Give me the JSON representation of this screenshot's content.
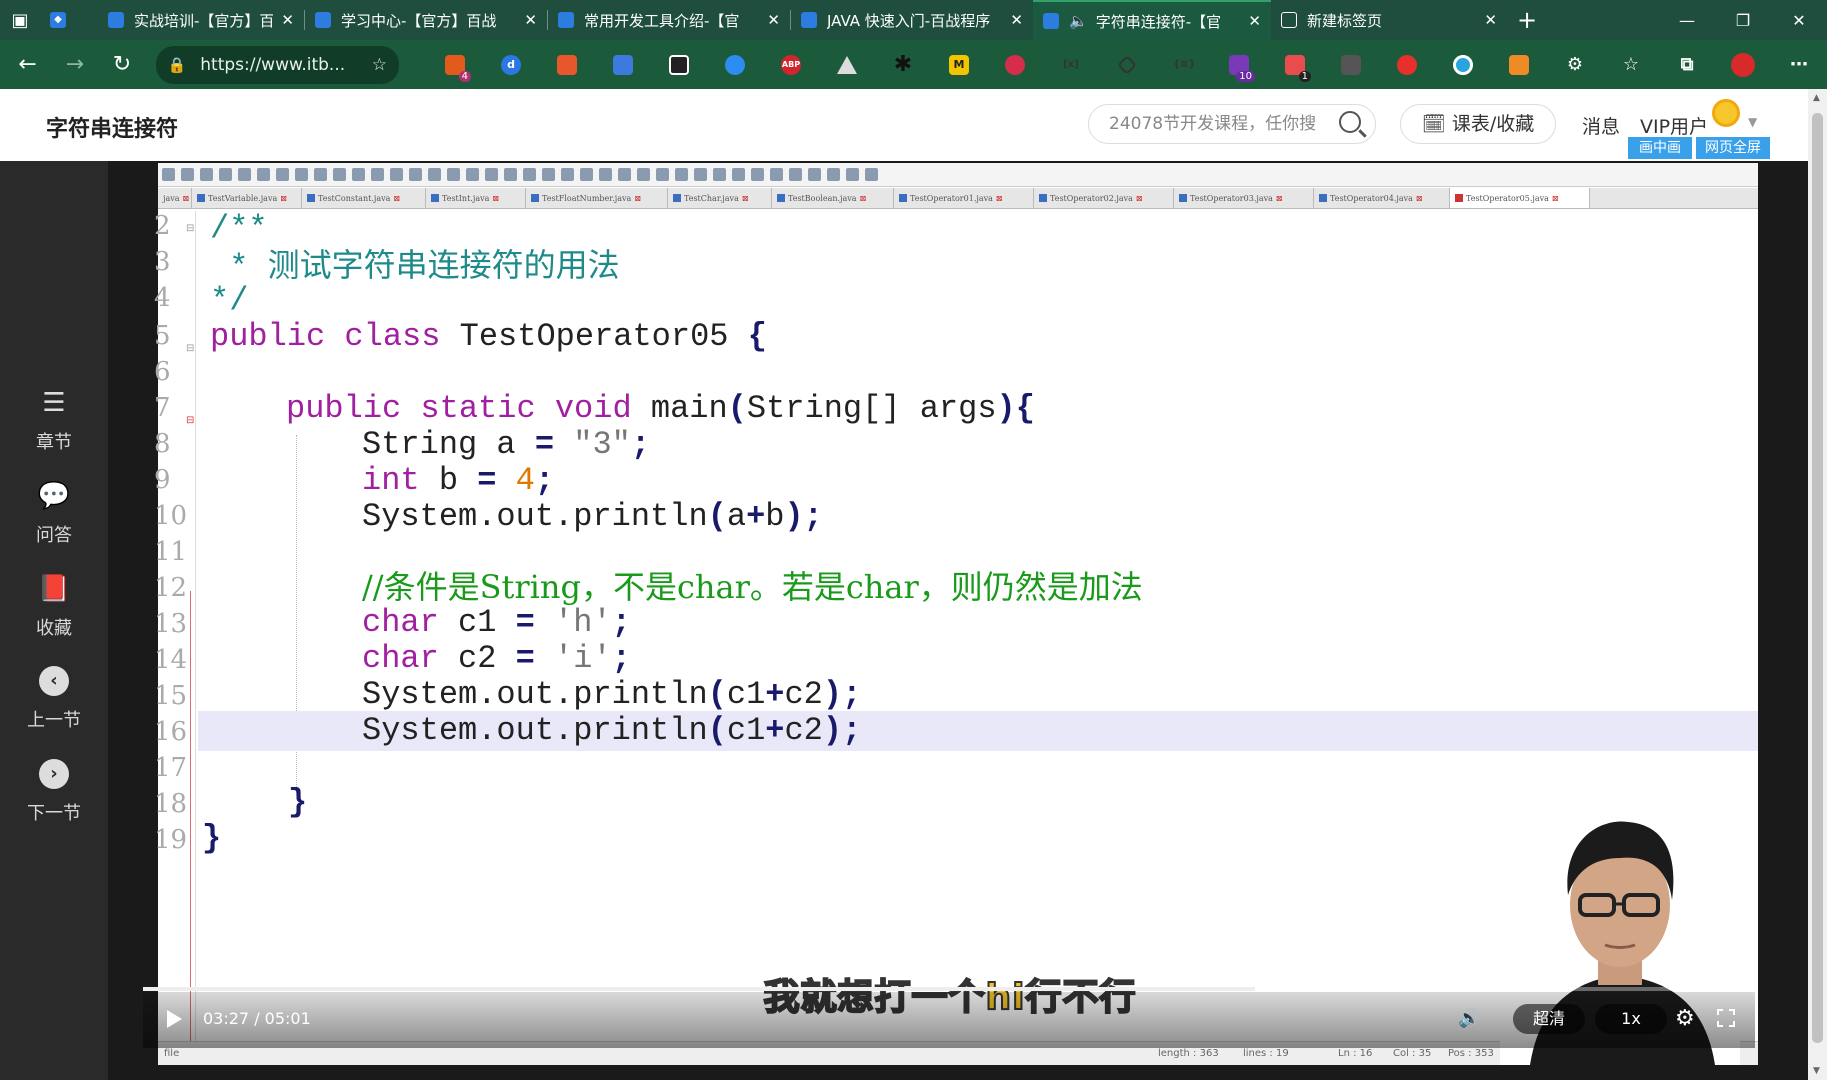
{
  "browser": {
    "tabs": [
      {
        "title": "实战培训-【官方】百战",
        "active": false
      },
      {
        "title": "学习中心-【官方】百战",
        "active": false
      },
      {
        "title": "常用开发工具介绍-【官",
        "active": false
      },
      {
        "title": "JAVA 快速入门-百战程序",
        "active": false
      },
      {
        "title": "字符串连接符-【官",
        "active": true
      },
      {
        "title": "新建标签页",
        "active": false
      }
    ],
    "new_tab": "+",
    "url": "https://www.itb...",
    "extension_badges": {
      "ext1": "4",
      "ext17": "10",
      "ext18": "1"
    },
    "extension_labels": {
      "abp": "ABP",
      "m": "M"
    }
  },
  "header": {
    "title": "字符串连接符",
    "search_placeholder": "24078节开发课程，任你搜",
    "courses_button": "课表/收藏",
    "messages": "消息",
    "vip": "VIP用户",
    "pip": "画中画",
    "fullscreen_page": "网页全屏"
  },
  "sidebar": {
    "items": [
      {
        "label": "章节",
        "icon": "list-icon"
      },
      {
        "label": "问答",
        "icon": "chat-icon"
      },
      {
        "label": "收藏",
        "icon": "bookmark-icon"
      },
      {
        "label": "上一节",
        "icon": "chevron-left-icon"
      },
      {
        "label": "下一节",
        "icon": "chevron-right-icon"
      }
    ]
  },
  "editor": {
    "file_tabs": [
      "java",
      "TestVariable.java",
      "TestConstant.java",
      "TestInt.java",
      "TestFloatNumber.java",
      "TestChar.java",
      "TestBoolean.java",
      "TestOperator01.java",
      "TestOperator02.java",
      "TestOperator03.java",
      "TestOperator04.java",
      "TestOperator05.java"
    ],
    "active_file": "TestOperator05.java",
    "line_numbers": [
      "2",
      "3",
      "4",
      "5",
      "6",
      "7",
      "8",
      "9",
      "10",
      "11",
      "12",
      "13",
      "14",
      "15",
      "16",
      "17",
      "18",
      "19"
    ],
    "code": {
      "l2": "/**",
      "l3_star": " * ",
      "l3_text": "测试字符串连接符的用法",
      "l4": "*/",
      "l5_kw": "public class",
      "l5_name": " TestOperator05 ",
      "l5_brace": "{",
      "l7_kw": "public static void",
      "l7_rest": " main",
      "l7_paren": "(",
      "l7_args": "String[] args",
      "l7_close": "){",
      "l8_a": "String a ",
      "l8_eq": "=",
      "l8_str": " \"3\"",
      "l8_semi": ";",
      "l9_kw": "int",
      "l9_b": " b ",
      "l9_eq": "=",
      "l9_num": " 4",
      "l9_semi": ";",
      "l10_a": "System.out.println",
      "l10_b": "(",
      "l10_c": "a",
      "l10_d": "+",
      "l10_e": "b",
      "l10_f": ");",
      "l12": "//条件是String，不是char。若是char，则仍然是加法",
      "l13_kw": "char",
      "l13_rest": " c1 ",
      "l13_eq": "=",
      "l13_str": " 'h'",
      "l13_semi": ";",
      "l14_kw": "char",
      "l14_rest": " c2 ",
      "l14_eq": "=",
      "l14_str": " 'i'",
      "l14_semi": ";",
      "l15_a": "System.out.println",
      "l15_b": "(",
      "l15_c": "c1",
      "l15_d": "+",
      "l15_e": "c2",
      "l15_f": ");",
      "l16_a": "System.out.println",
      "l16_b": "(",
      "l16_c": "c1",
      "l16_d": "+",
      "l16_e": "c2",
      "l16_f": ");",
      "l18": "}",
      "l19": "}"
    },
    "status": {
      "left": "file",
      "length": "length : 363",
      "lines": "lines : 19",
      "ln": "Ln : 16",
      "col": "Col : 35",
      "pos": "Pos : 353"
    }
  },
  "player": {
    "time": "03:27 / 05:01",
    "progress": 0.69,
    "subtitle": "我就想打一个hi行不行",
    "quality": "超清",
    "speed": "1x"
  }
}
